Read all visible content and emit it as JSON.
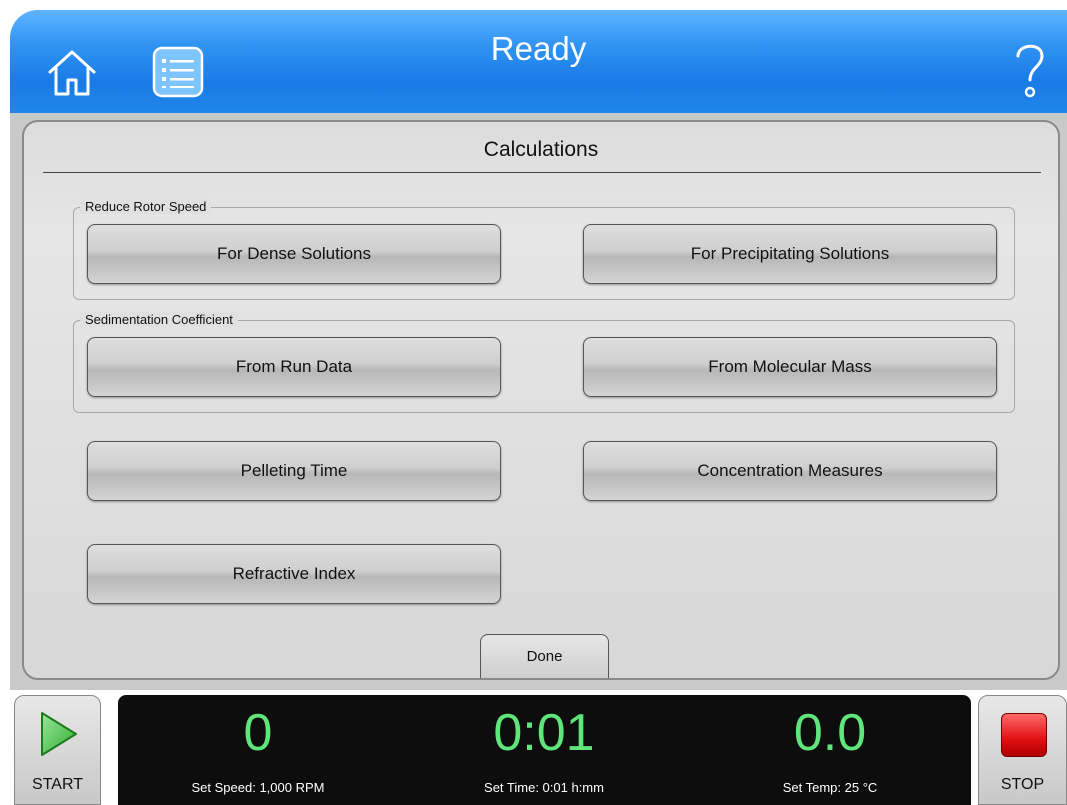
{
  "header": {
    "title": "Ready",
    "home_icon": "home-icon",
    "menu_icon": "list-icon",
    "help_icon": "help-icon"
  },
  "panel": {
    "title": "Calculations",
    "groups": [
      {
        "label": "Reduce Rotor Speed"
      },
      {
        "label": "Sedimentation Coefficient"
      }
    ],
    "buttons": {
      "dense": "For Dense Solutions",
      "precipitating": "For Precipitating Solutions",
      "run_data": "From Run Data",
      "molecular_mass": "From Molecular Mass",
      "pelleting": "Pelleting Time",
      "concentration": "Concentration Measures",
      "refractive": "Refractive Index"
    },
    "done": "Done"
  },
  "footer": {
    "start": "START",
    "stop": "STOP",
    "speed": {
      "value": "0",
      "label": "Set Speed: 1,000 RPM"
    },
    "time": {
      "value": "0:01",
      "label": "Set Time: 0:01 h:mm"
    },
    "temp": {
      "value": "0.0",
      "label": "Set Temp: 25 °C"
    }
  },
  "colors": {
    "header_blue": "#1f86ea",
    "readout_green": "#5fe57a",
    "stop_red": "#e01010",
    "start_green": "#2fb02f"
  }
}
